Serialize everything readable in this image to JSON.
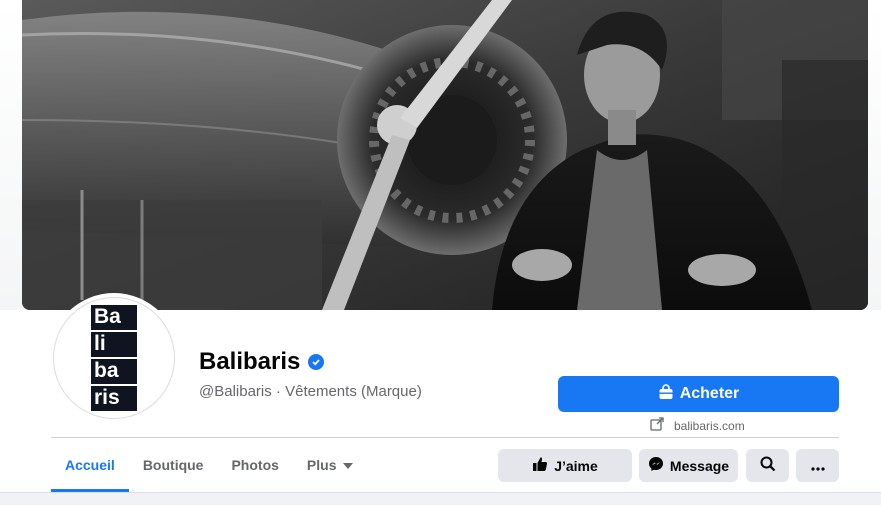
{
  "page": {
    "name": "Balibaris",
    "handle": "@Balibaris",
    "separator": " · ",
    "category": "Vêtements (Marque)",
    "verified": true
  },
  "logo": {
    "lines": [
      "Ba",
      "li",
      "ba",
      "ris"
    ]
  },
  "actions": {
    "buy_label": "Acheter",
    "website": "balibaris.com",
    "like_label": "J’aime",
    "message_label": "Message"
  },
  "tabs": [
    {
      "label": "Accueil",
      "active": true
    },
    {
      "label": "Boutique",
      "active": false
    },
    {
      "label": "Photos",
      "active": false
    },
    {
      "label": "Plus",
      "active": false,
      "dropdown": true
    }
  ],
  "icons": {
    "verified": "verified-badge-icon",
    "buy": "shopping-bag-icon",
    "website": "external-link-icon",
    "like": "thumbs-up-icon",
    "message": "messenger-icon",
    "search": "search-icon",
    "more": "more-options-icon",
    "dropdown": "caret-down-icon"
  },
  "colors": {
    "accent": "#1877f2",
    "button_gray": "#e4e6eb",
    "text_secondary": "#65676b",
    "logo_dark": "#0f1420"
  }
}
